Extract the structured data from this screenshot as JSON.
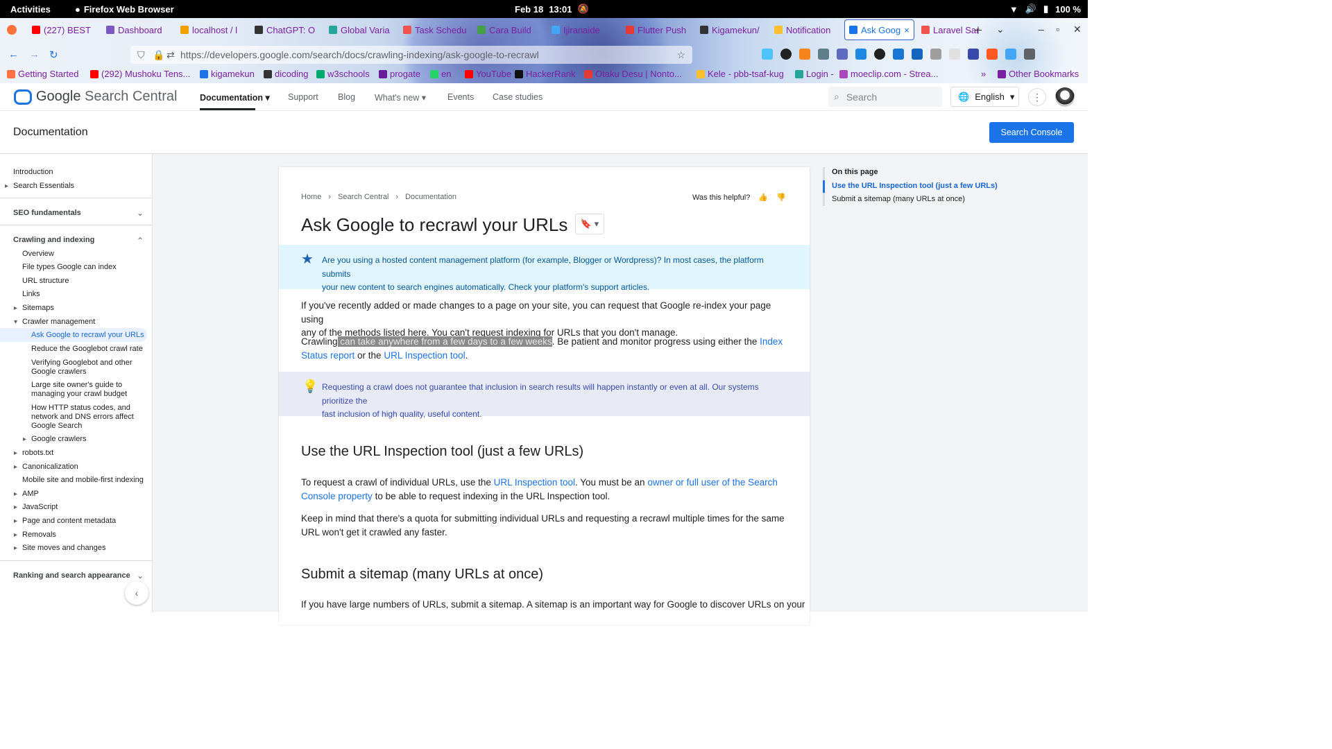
{
  "os": {
    "activities": "Activities",
    "app_name": "Firefox Web Browser",
    "date": "Feb 18",
    "time": "13:01",
    "battery": "100 %"
  },
  "browser": {
    "tabs": [
      {
        "label": "(227) BEST",
        "color": "#ff0000"
      },
      {
        "label": "Dashboard",
        "color": "#7e57c2"
      },
      {
        "label": "localhost / l",
        "color": "#f0a000"
      },
      {
        "label": "ChatGPT: O",
        "color": "#333333"
      },
      {
        "label": "Global Varia",
        "color": "#26a69a"
      },
      {
        "label": "Task Schedu",
        "color": "#ef5350"
      },
      {
        "label": "Cara Build",
        "color": "#43a047"
      },
      {
        "label": "Ijiranaide",
        "color": "#42a5f5"
      },
      {
        "label": "Flutter Push",
        "color": "#e53935"
      },
      {
        "label": "Kigamekun/",
        "color": "#333333"
      },
      {
        "label": "Notification",
        "color": "#fbc02d"
      },
      {
        "label": "Ask Goog",
        "color": "#1a73e8",
        "active": true
      },
      {
        "label": "Laravel Sar",
        "color": "#ef5350"
      }
    ],
    "url": "https://developers.google.com/search/docs/crawling-indexing/ask-google-to-recrawl",
    "bookmarks": [
      {
        "label": "Getting Started",
        "color": "#ff7043"
      },
      {
        "label": "(292) Mushoku Tens...",
        "color": "#ff0000"
      },
      {
        "label": "kigamekun",
        "color": "#1a73e8"
      },
      {
        "label": "dicoding",
        "color": "#333333"
      },
      {
        "label": "w3schools",
        "color": "#04aa6d"
      },
      {
        "label": "progate",
        "color": "#6a1b9a"
      },
      {
        "label": "en",
        "color": "#25d366"
      },
      {
        "label": "YouTube",
        "color": "#ff0000"
      },
      {
        "label": "HackerRank",
        "color": "#111111"
      },
      {
        "label": "Otaku Desu | Nonto...",
        "color": "#e53935"
      },
      {
        "label": "Kele - pbb-tsaf-kug",
        "color": "#fbc02d"
      },
      {
        "label": "Login -",
        "color": "#26a69a"
      },
      {
        "label": "moeclip.com - Strea...",
        "color": "#ab47bc"
      },
      {
        "label": "Other Bookmarks",
        "color": "#7b1fa2"
      }
    ]
  },
  "site": {
    "logo_google": "Google",
    "logo_rest": " Search Central",
    "nav": {
      "documentation": "Documentation",
      "support": "Support",
      "blog": "Blog",
      "whats_new": "What's new",
      "events": "Events",
      "case_studies": "Case studies"
    },
    "search_placeholder": "Search",
    "language": "English",
    "doc_title": "Documentation",
    "console_button": "Search Console"
  },
  "leftnav": {
    "introduction": "Introduction",
    "search_essentials": "Search Essentials",
    "seo_fundamentals": "SEO fundamentals",
    "crawling_indexing": "Crawling and indexing",
    "overview": "Overview",
    "file_types": "File types Google can index",
    "url_structure": "URL structure",
    "links": "Links",
    "sitemaps": "Sitemaps",
    "crawler_management": "Crawler management",
    "ask_google": "Ask Google to recrawl your URLs",
    "reduce_rate": "Reduce the Googlebot crawl rate",
    "verifying_1": "Verifying Googlebot and other",
    "verifying_2": "Google crawlers",
    "large_site_1": "Large site owner's guide to",
    "large_site_2": "managing your crawl budget",
    "http_1": "How HTTP status codes, and",
    "http_2": "network and DNS errors affect",
    "http_3": "Google Search",
    "google_crawlers": "Google crawlers",
    "robots": "robots.txt",
    "canonicalization": "Canonicalization",
    "mobile": "Mobile site and mobile-first indexing",
    "amp": "AMP",
    "javascript": "JavaScript",
    "page_metadata": "Page and content metadata",
    "removals": "Removals",
    "site_moves": "Site moves and changes",
    "ranking": "Ranking and search appearance"
  },
  "article": {
    "breadcrumbs": [
      "Home",
      "Search Central",
      "Documentation"
    ],
    "helpful": "Was this helpful?",
    "title": "Ask Google to recrawl your URLs",
    "note1_line1": "Are you using a hosted content management platform (for example, Blogger or Wordpress)? In most cases, the platform submits",
    "note1_line2": "your new content to search engines automatically. Check your platform's support articles.",
    "p1_line1": "If you've recently added or made changes to a page on your site, you can request that Google re-index your page using",
    "p1_line2": "any of the methods listed here. You can't request indexing for URLs that you don't manage.",
    "p2_a": "Crawling",
    "p2_highlight": " can take anywhere from a few days to a few weeks",
    "p2_b": ". Be patient and monitor progress using either the ",
    "p2_link1a": "Index",
    "p2_link1b": "Status report",
    "p2_c": " or the ",
    "p2_link2": "URL Inspection tool",
    "p2_d": ".",
    "note2_line1": "Requesting a crawl does not guarantee that inclusion in search results will happen instantly or even at all. Our systems prioritize the",
    "note2_line2": "fast inclusion of high quality, useful content.",
    "h2_inspection": "Use the URL Inspection tool (just a few URLs)",
    "p3_a": "To request a crawl of individual URLs, use the ",
    "p3_link1": "URL Inspection tool",
    "p3_b": ". You must be an ",
    "p3_link2a": "owner or full user of the Search",
    "p3_link2b": "Console property",
    "p3_c": " to be able to request indexing in the URL Inspection tool.",
    "p4_line1": "Keep in mind that there's a quota for submitting individual URLs and requesting a recrawl multiple times for the same",
    "p4_line2": "URL won't get it crawled any faster.",
    "h2_sitemap": "Submit a sitemap (many URLs at once)",
    "p5": "If you have large numbers of URLs, submit a sitemap. A sitemap is an important way for Google to discover URLs on your"
  },
  "toc": {
    "heading": "On this page",
    "item1": "Use the URL Inspection tool (just a few URLs)",
    "item2": "Submit a sitemap (many URLs at once)"
  }
}
